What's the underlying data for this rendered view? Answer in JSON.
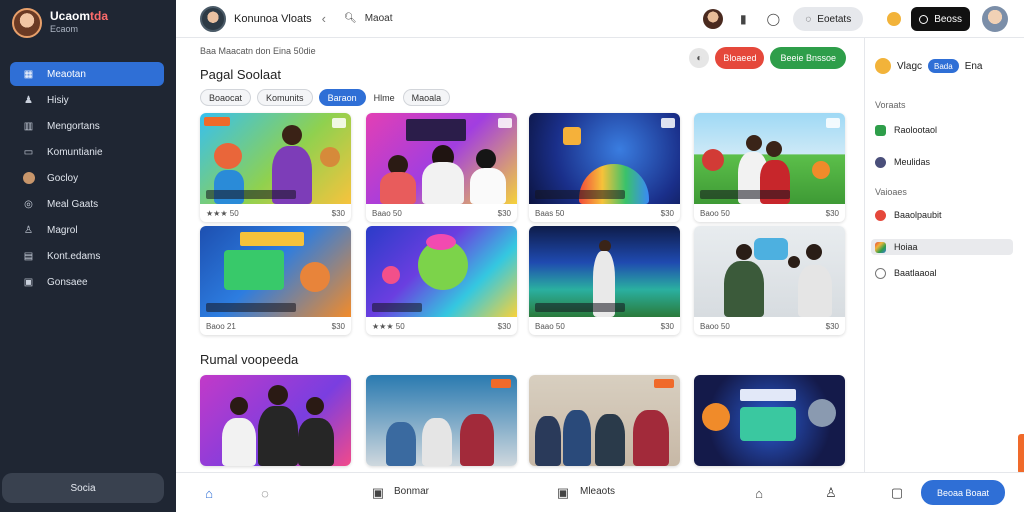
{
  "sidebar": {
    "profile": {
      "name_main": "Ucaom",
      "name_accent": "tda",
      "subtitle": "Ecaom"
    },
    "items": [
      {
        "label": "Meaotan",
        "icon": "grid-icon",
        "active": true
      },
      {
        "label": "Hisiy",
        "icon": "person-icon"
      },
      {
        "label": "Mengortans",
        "icon": "chart-icon"
      },
      {
        "label": "Komuntianie",
        "icon": "folder-icon"
      },
      {
        "label": "Gocloy",
        "icon": "avatar-dot-icon"
      },
      {
        "label": "Meal Gaats",
        "icon": "target-icon"
      },
      {
        "label": "Magrol",
        "icon": "user-icon"
      },
      {
        "label": "Kont.edams",
        "icon": "table-icon"
      },
      {
        "label": "Gonsaee",
        "icon": "box-icon"
      }
    ],
    "bottom_button": "Socia"
  },
  "topbar": {
    "title": "Konunoa Vloats",
    "back_icon": "chevron-left-icon",
    "search_label": "Maoat",
    "pill_label": "Eoetats",
    "dark_label": "Beoss"
  },
  "main": {
    "breadcrumb": "Baa Maacatn don Eina 50die",
    "red_button": "Bloaeed",
    "green_button": "Beeie Bnssoe",
    "section1_title": "Pagal Soolaat",
    "chips": [
      {
        "label": "Boaocat",
        "style": "normal"
      },
      {
        "label": "Komunits",
        "style": "normal"
      },
      {
        "label": "Baraon",
        "style": "active"
      },
      {
        "label": "Hlme",
        "style": "plain"
      },
      {
        "label": "Maoala",
        "style": "normal"
      }
    ],
    "section2_title": "Rumal voopeeda",
    "cards": [
      {
        "left": "★★★ 50",
        "right": "$30",
        "stars": true
      },
      {
        "left": "Baao 50",
        "right": "$30",
        "stars": false
      },
      {
        "left": "Baas 50",
        "right": "$30",
        "stars": false
      },
      {
        "left": "Baoo 50",
        "right": "$30",
        "stars": false
      },
      {
        "left": "Baoo 21",
        "right": "$30",
        "stars": false
      },
      {
        "left": "★★★ 50",
        "right": "$30",
        "stars": true
      },
      {
        "left": "Baao 50",
        "right": "$30",
        "stars": false
      },
      {
        "left": "Baoo 50",
        "right": "$30",
        "stars": false
      }
    ]
  },
  "rpanel": {
    "head_label": "Vlagc",
    "head_badge": "Bada",
    "head_suffix": "Ena",
    "section1": "Voraats",
    "section2": "Vaioaes",
    "items": [
      {
        "label": "Raolootaol",
        "icon_color": "#2e9e4a"
      },
      {
        "label": "Meulidas",
        "icon_color": "#4a4f7a"
      },
      {
        "label": "Baaolpaubit",
        "icon_color": "#e5483b"
      },
      {
        "label": "Hoiaa",
        "icon_color": "#3a7bd5",
        "highlight": true
      },
      {
        "label": "Baatlaaoal",
        "icon_color": "#777777"
      }
    ]
  },
  "bottombar": {
    "label1": "Bonmar",
    "label2": "Mleaots",
    "primary_button": "Beoaa Boaat"
  }
}
